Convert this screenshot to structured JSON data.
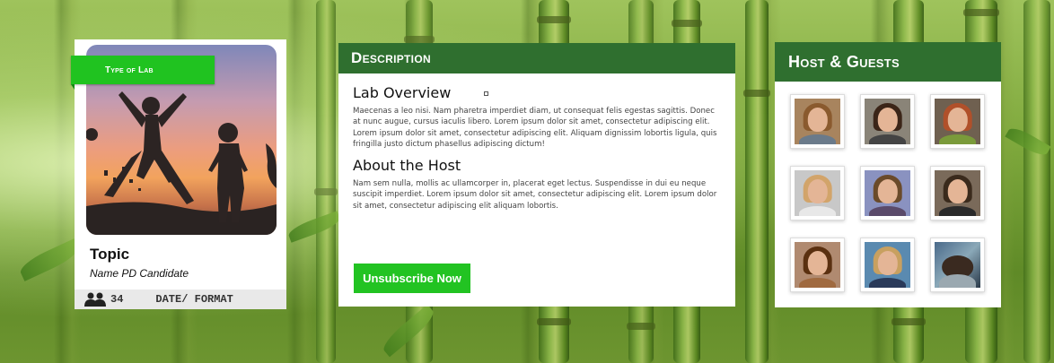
{
  "lab_card": {
    "type_label": "Type of Lab",
    "topic": "Topic",
    "candidate": "Name PD Candidate",
    "attendees": "34",
    "date_format": "DATE/ FORMAT"
  },
  "description": {
    "header": "Description",
    "overview_title": "Lab Overview",
    "overview_text": "Maecenas a leo nisi. Nam pharetra imperdiet diam, ut consequat felis egestas sagittis. Donec at nunc augue, cursus iaculis libero. Lorem ipsum dolor sit amet, consectetur adipiscing elit. Lorem ipsum dolor sit amet, consectetur adipiscing elit. Aliquam dignissim lobortis ligula, quis fringilla justo dictum phasellus adipiscing dictum!",
    "host_title": "About the Host",
    "host_text": "Nam sem nulla, mollis ac ullamcorper in, placerat eget lectus. Suspendisse in dui eu neque suscipit imperdiet. Lorem ipsum dolor sit amet, consectetur adipiscing elit. Lorem ipsum dolor sit amet, consectetur adipiscing elit aliquam lobortis.",
    "button_label": "Unsubscribe Now"
  },
  "host_panel": {
    "header": "Host & Guests"
  },
  "colors": {
    "header_green": "#2f6f2f",
    "accent_green": "#22c322"
  }
}
